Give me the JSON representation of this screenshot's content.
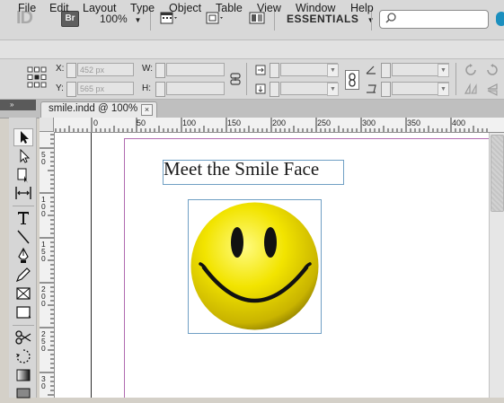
{
  "app_bar": {
    "logo": "ID",
    "bridge_button": "Br",
    "zoom_level": "100%",
    "workspace": "ESSENTIALS"
  },
  "menu": [
    "File",
    "Edit",
    "Layout",
    "Type",
    "Object",
    "Table",
    "View",
    "Window",
    "Help"
  ],
  "control_panel": {
    "x_label": "X:",
    "x_value": "452 px",
    "y_label": "Y:",
    "y_value": "565 px",
    "w_label": "W:",
    "h_label": "H:"
  },
  "document_tab": {
    "title": "smile.indd @ 100%",
    "close_glyph": "×"
  },
  "panel_toggle": "»",
  "ruler": {
    "h_labels": [
      "0",
      "50",
      "100",
      "150",
      "200",
      "250",
      "300",
      "350",
      "400"
    ],
    "v_labels": [
      "5\n0",
      "1\n0\n0",
      "1\n5\n0",
      "2\n0\n0",
      "2\n5\n0",
      "3\n0"
    ]
  },
  "document": {
    "headline": "Meet the Smile Face"
  },
  "colors": {
    "frame_selection": "#6f9fc4",
    "margin_guide": "#b06ab0",
    "smiley_yellow": "#f2e400"
  },
  "icons": {
    "tools": [
      "selection-icon",
      "direct-selection-icon",
      "page-icon",
      "gap-icon",
      "type-icon",
      "line-icon",
      "pen-icon",
      "pencil-icon",
      "rectangle-frame-icon",
      "rectangle-icon",
      "scissors-icon",
      "free-transform-icon",
      "gradient-icon"
    ]
  }
}
